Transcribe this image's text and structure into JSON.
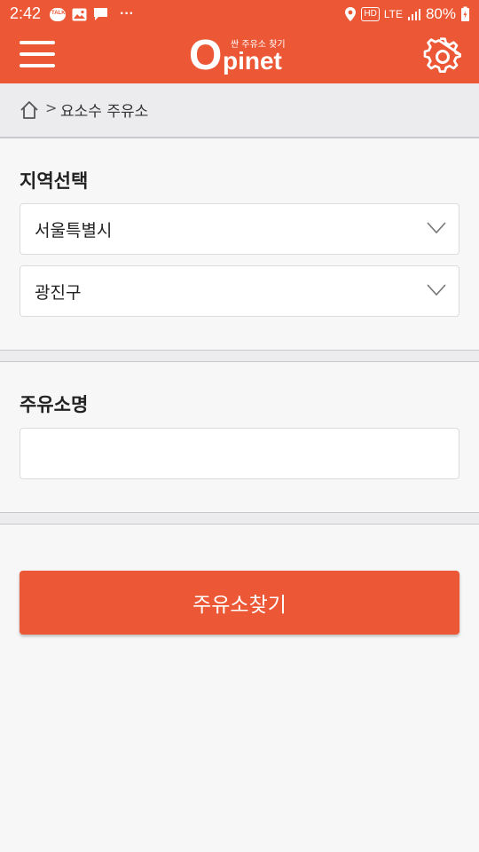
{
  "status_bar": {
    "time": "2:42",
    "left_icons": [
      "kakaotalk-icon",
      "gallery-icon",
      "message-icon",
      "more-icon"
    ],
    "kakao_text": "TALK",
    "more_text": "···",
    "hd": "HD",
    "lte": "LTE",
    "battery": "80%"
  },
  "app_bar": {
    "logo_sub": "싼 주유소 찾기",
    "logo_o": "O",
    "logo_rest": "pinet"
  },
  "breadcrumb": {
    "separator": ">",
    "label": "요소수 주유소"
  },
  "region": {
    "title": "지역선택",
    "city": "서울특별시",
    "district": "광진구"
  },
  "station": {
    "title": "주유소명",
    "value": "",
    "placeholder": ""
  },
  "search_button": "주유소찾기",
  "colors": {
    "brand": "#ec5836",
    "background": "#f7f7f7"
  }
}
